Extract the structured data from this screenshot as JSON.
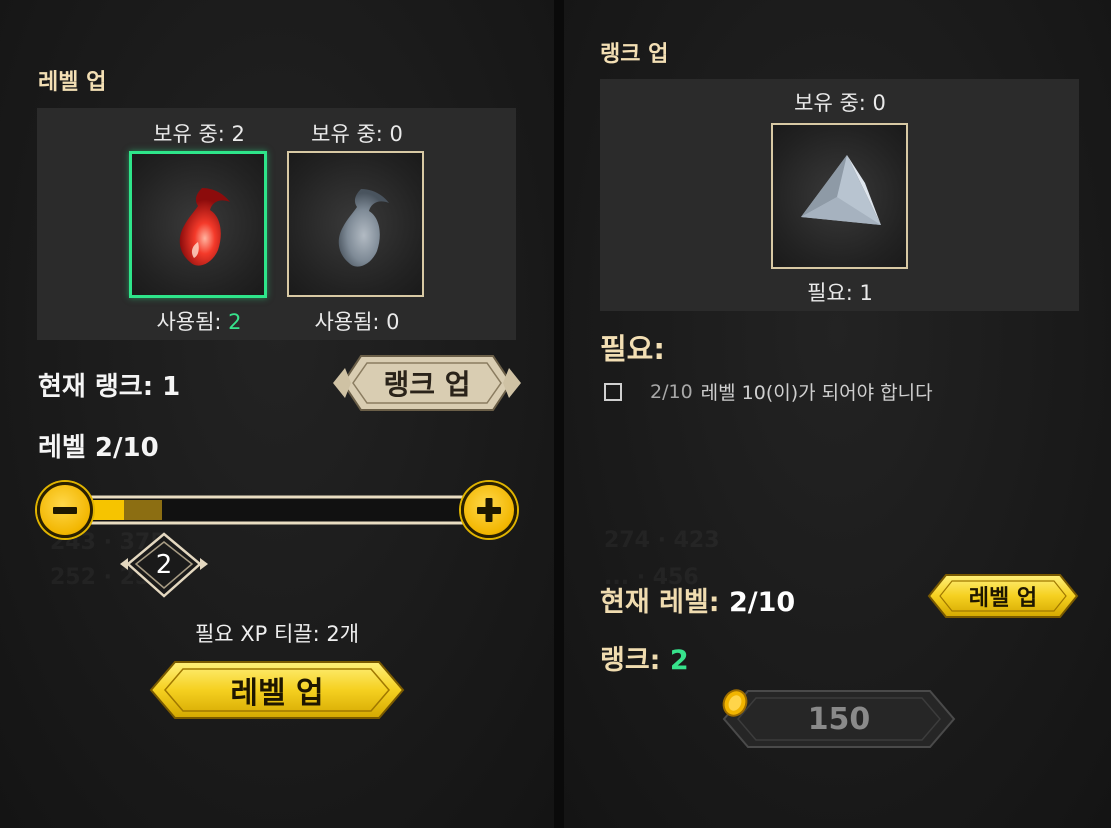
{
  "left": {
    "section_title": "레벨 업",
    "items": [
      {
        "owned_label": "보유 중: 2",
        "used_prefix": "사용됨: ",
        "used_value": "2",
        "icon": "red-flame-icon"
      },
      {
        "owned_label": "보유 중: 0",
        "used_prefix": "사용됨: ",
        "used_value": "0",
        "icon": "blue-flame-icon"
      }
    ],
    "current_rank": "현재 랭크: 1",
    "rank_up_button": "랭크 업",
    "level_label": "레벨 2/10",
    "slider": {
      "value": 2,
      "max": 10,
      "filled_fraction": 0.1,
      "preview_fraction": 0.2
    },
    "slider_marker": "2",
    "xp_required": "필요 XP 티끌: 2개",
    "level_up_button": "레벨 업"
  },
  "right": {
    "section_title": "랭크 업",
    "owned_label": "보유 중: 0",
    "item_icon": "crystal-shard-icon",
    "required_label": "필요: 1",
    "requirements_title": "필요:",
    "requirement": {
      "progress": "2/10",
      "text": "레벨 10(이)가 되어야 합니다"
    },
    "current_level_label": "현재 레벨: ",
    "current_level_value": "2/10",
    "level_up_button": "레벨 업",
    "rank_label": "랭크: ",
    "rank_value": "2",
    "cost_button": "150",
    "cost_icon": "gold-coin-icon"
  },
  "colors": {
    "accent_gold": "#f2c200",
    "title_cream": "#f3dfb4",
    "highlight_green": "#37e38c",
    "panel_bg": "#1a1a1a"
  }
}
